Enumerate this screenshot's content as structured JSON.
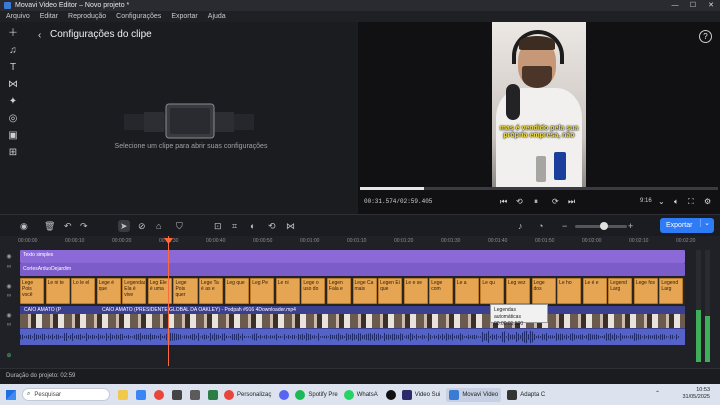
{
  "window": {
    "title": "Movavi Video Editor – Novo projeto *",
    "controls": [
      "—",
      "☐",
      "✕"
    ]
  },
  "menu": [
    "Arquivo",
    "Editar",
    "Reprodução",
    "Configurações",
    "Exportar",
    "Ajuda"
  ],
  "clip_panel": {
    "title": "Configurações do clipe",
    "hint": "Selecione um clipe para abrir suas configurações"
  },
  "preview": {
    "caption": "mas é vendido pela sua própria empresa, não",
    "timecode": "00:31.574/02:59.405",
    "aspect_ratio": "9:16",
    "progress": 0.18
  },
  "timeline_toolbar": {
    "export_label": "Exportar",
    "zoom_level": 0.48
  },
  "ruler": [
    "00:00:00",
    "00:00:10",
    "00:00:20",
    "00:00:30",
    "00:00:40",
    "00:00:50",
    "00:01:00",
    "00:01:10",
    "00:01:20",
    "00:01:30",
    "00:01:40",
    "00:01:50",
    "00:02:00",
    "00:02:10",
    "00:02:20"
  ],
  "tracks": {
    "text1": "Texto simples",
    "text2": "CortesArduoDejardim",
    "subtitles": [
      "Lege Pois você",
      "Le ni te",
      "Lo le el",
      "Lege é que",
      "Legendas Ela é vive",
      "Leg Ele é uma",
      "Lege Pois quer",
      "Lege Ta é as e",
      "Leg que",
      "Leg Pe",
      "Le ni",
      "Lege o uso do",
      "Legen Fala e",
      "Lege Ca mais",
      "Legen Ei que",
      "Le e se",
      "Lege com",
      "Le a",
      "Le qu",
      "Leg vez",
      "Lege dos",
      "Le ho",
      "Le é e",
      "Legend Larg",
      "Lege fos",
      "Legend Larg"
    ],
    "video_left": "CAIO AMATO (P",
    "video_main": "CAIO AMATO (PRESIDENTE GLOBAL DA OAKLEY) - Podpah #916 4Downloader.mp4"
  },
  "tooltip": {
    "title": "Legendas automáticas",
    "duration": "00:00:01.500"
  },
  "status": {
    "duration_label": "Duração do projeto: 02:59"
  },
  "taskbar": {
    "search_placeholder": "Pesquisar",
    "apps": [
      "Personalizaç",
      "Spotify Pre",
      "WhatsA",
      "Video Sui",
      "Movavi Video",
      "Adapta C"
    ],
    "time": "10:53",
    "date": "31/05/2025"
  },
  "colors": {
    "accent": "#2f7bf5",
    "text_track": "#8b6ad8",
    "subtitle_clip": "#e6a553",
    "video_track": "#3b3f8f",
    "audio_track": "#5563c9",
    "playhead": "#ff6a3c"
  }
}
